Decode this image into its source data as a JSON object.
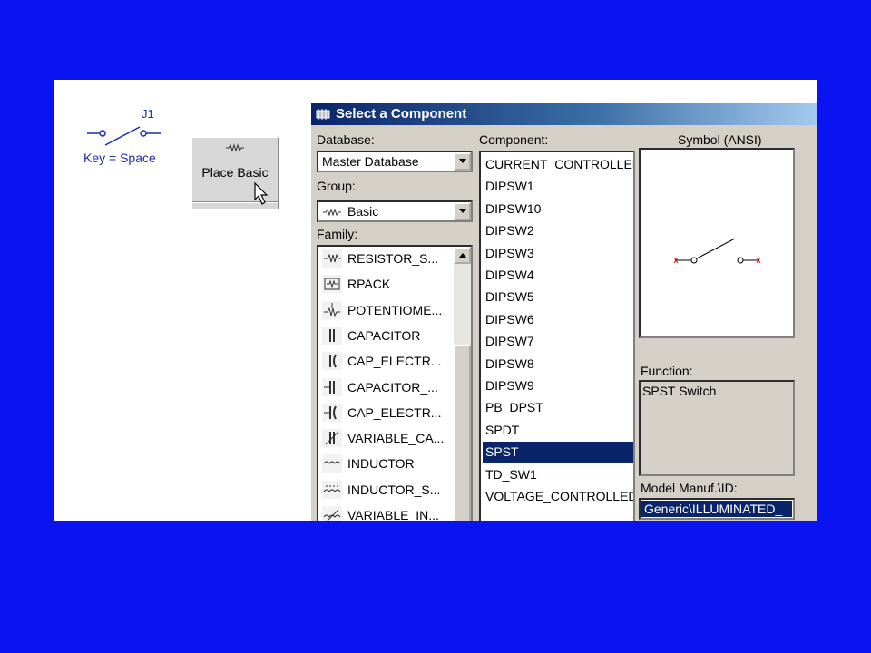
{
  "schematic": {
    "ref": "J1",
    "key_label": "Key = Space"
  },
  "toolbar": {
    "place_basic_label": "Place Basic"
  },
  "dialog": {
    "title": "Select a Component",
    "database": {
      "label": "Database:",
      "value": "Master Database"
    },
    "group": {
      "label": "Group:",
      "value": "Basic"
    },
    "family": {
      "label": "Family:",
      "items": [
        {
          "label": "RESISTOR_S...",
          "icon": "resistor-icon"
        },
        {
          "label": "RPACK",
          "icon": "rpack-icon"
        },
        {
          "label": "POTENTIOME...",
          "icon": "potentiometer-icon"
        },
        {
          "label": "CAPACITOR",
          "icon": "capacitor-icon"
        },
        {
          "label": "CAP_ELECTR...",
          "icon": "cap-electrolytic-icon"
        },
        {
          "label": "CAPACITOR_...",
          "icon": "capacitor-variant-icon"
        },
        {
          "label": "CAP_ELECTR...",
          "icon": "cap-electrolytic-variant-icon"
        },
        {
          "label": "VARIABLE_CA...",
          "icon": "variable-capacitor-icon"
        },
        {
          "label": "INDUCTOR",
          "icon": "inductor-icon"
        },
        {
          "label": "INDUCTOR_S...",
          "icon": "inductor-s-icon"
        },
        {
          "label": "VARIABLE_IN...",
          "icon": "variable-inductor-icon"
        }
      ]
    },
    "component": {
      "label": "Component:",
      "items": [
        "CURRENT_CONTROLLED",
        "DIPSW1",
        "DIPSW10",
        "DIPSW2",
        "DIPSW3",
        "DIPSW4",
        "DIPSW5",
        "DIPSW6",
        "DIPSW7",
        "DIPSW8",
        "DIPSW9",
        "PB_DPST",
        "SPDT",
        "SPST",
        "TD_SW1",
        "VOLTAGE_CONTROLLED"
      ],
      "selected": "SPST"
    },
    "symbol": {
      "label": "Symbol (ANSI)"
    },
    "function": {
      "label": "Function:",
      "value": "SPST Switch"
    },
    "model": {
      "label": "Model Manuf.\\ID:",
      "value": "Generic\\ILLUMINATED_"
    }
  },
  "colors": {
    "background": "#0a14f0",
    "selection": "#0a246a",
    "dialog": "#d4d0c8"
  }
}
